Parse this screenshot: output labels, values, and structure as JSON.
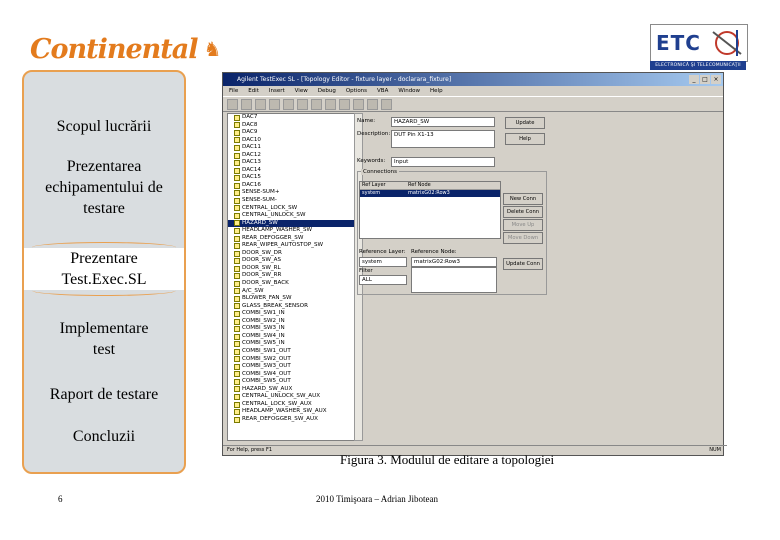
{
  "brand": {
    "logo_text": "Continental",
    "logo_icon": "horse-icon"
  },
  "etc_logo": {
    "letters": "ETC",
    "caption": "ELECTRONICĂ ŞI TELECOMUNICAŢII"
  },
  "nav": {
    "items": [
      {
        "label": "Scopul lucrării"
      },
      {
        "label": "Prezentarea echipamentului de testare"
      },
      {
        "label": "Prezentare Test.Exec.SL",
        "active": true
      },
      {
        "label": "Implementare test"
      },
      {
        "label": "Raport de testare"
      },
      {
        "label": "Concluzii"
      }
    ]
  },
  "app": {
    "title": "Agilent TestExec SL - [Topology Editor - fixture layer - doclarara_fixture]",
    "menu": [
      "File",
      "Edit",
      "Insert",
      "View",
      "Debug",
      "Options",
      "VBA",
      "Window",
      "Help"
    ],
    "tree": [
      "DAC7",
      "DAC8",
      "DAC9",
      "DAC10",
      "DAC11",
      "DAC12",
      "DAC13",
      "DAC14",
      "DAC15",
      "DAC16",
      "SENSE-SUM+",
      "SENSE-SUM-",
      "CENTRAL_LOCK_SW",
      "CENTRAL_UNLOCK_SW",
      "HAZARD_SW",
      "HEADLAMP_WASHER_SW",
      "REAR_DEFOGGER_SW",
      "REAR_WIPER_AUTOSTOP_SW",
      "DOOR_SW_DR",
      "DOOR_SW_AS",
      "DOOR_SW_RL",
      "DOOR_SW_RR",
      "DOOR_SW_BACK",
      "A/C_SW",
      "BLOWER_FAN_SW",
      "GLASS_BREAK_SENSOR",
      "COMBI_SW1_IN",
      "COMBI_SW2_IN",
      "COMBI_SW3_IN",
      "COMBI_SW4_IN",
      "COMBI_SW5_IN",
      "COMBI_SW1_OUT",
      "COMBI_SW2_OUT",
      "COMBI_SW3_OUT",
      "COMBI_SW4_OUT",
      "COMBI_SW5_OUT",
      "HAZARD_SW_AUX",
      "CENTRAL_UNLOCK_SW_AUX",
      "CENTRAL_LOCK_SW_AUX",
      "HEADLAMP_WASHER_SW_AUX",
      "REAR_DEFOGGER_SW_AUX"
    ],
    "tree_selected": "HAZARD_SW",
    "form": {
      "name_label": "Name:",
      "name_value": "HAZARD_SW",
      "description_label": "Description:",
      "description_value": "DUT Pin X1-13",
      "keywords_label": "Keywords:",
      "keywords_value": "Input",
      "connections_label": "Connections",
      "grid_headers": [
        "Ref Layer",
        "Ref Node"
      ],
      "grid_row": [
        "system",
        "matrixG02:Row3"
      ],
      "ref_layer_label": "Reference Layer:",
      "ref_layer_value": "system",
      "ref_node_label": "Reference Node:",
      "ref_node_value": "matrixG02:Row3",
      "filter_label": "Filter",
      "filter_value": "ALL"
    },
    "buttons": {
      "update": "Update",
      "help": "Help",
      "new_conn": "New Conn",
      "delete_conn": "Delete Conn",
      "move_up": "Move Up",
      "move_down": "Move Down",
      "update_conn": "Update Conn"
    },
    "status_left": "For Help, press F1",
    "status_right": "NUM"
  },
  "caption": "Figura 3. Modulul de editare a topologiei",
  "footer": {
    "page": "6",
    "center": "2010 Timişoara – Adrian Jibotean"
  }
}
